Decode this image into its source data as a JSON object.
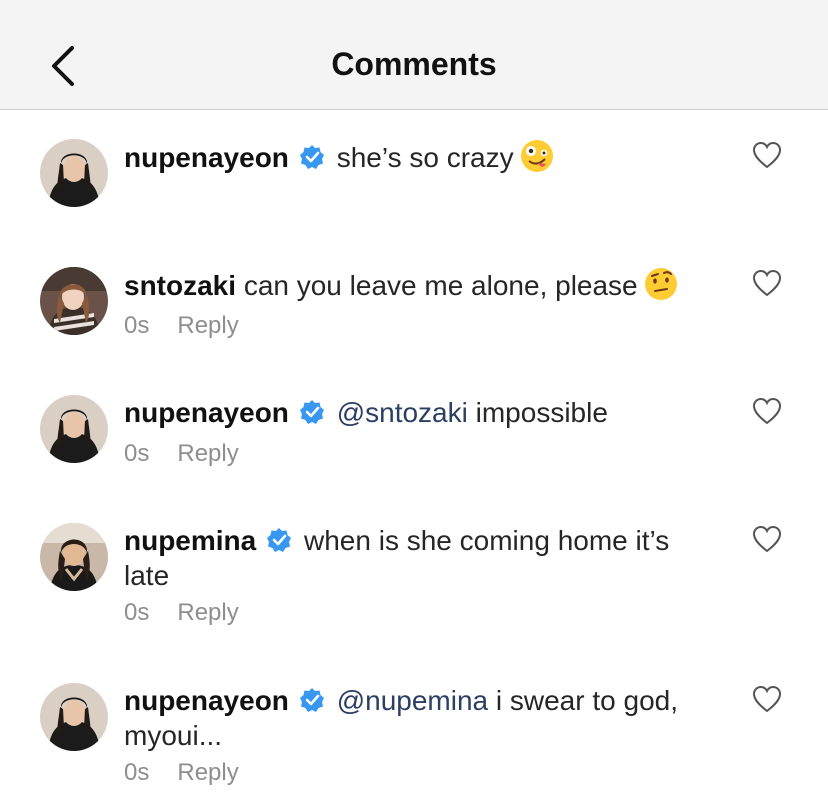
{
  "header": {
    "title": "Comments"
  },
  "comments": [
    {
      "username": "nupenayeon",
      "verified": true,
      "mention": "",
      "text": "she’s so crazy",
      "emoji": "zany-face",
      "time": "",
      "reply_label": ""
    },
    {
      "username": "sntozaki",
      "verified": false,
      "mention": "",
      "text": "can you leave me alone, please",
      "emoji": "raised-eyebrow-face",
      "time": "0s",
      "reply_label": "Reply"
    },
    {
      "username": "nupenayeon",
      "verified": true,
      "mention": "@sntozaki",
      "text": "impossible",
      "emoji": "",
      "time": "0s",
      "reply_label": "Reply"
    },
    {
      "username": "nupemina",
      "verified": true,
      "mention": "",
      "text": "when is she coming home it’s late",
      "emoji": "",
      "time": "0s",
      "reply_label": "Reply"
    },
    {
      "username": "nupenayeon",
      "verified": true,
      "mention": "@nupemina",
      "text": "i swear to god, myoui...",
      "emoji": "",
      "time": "0s",
      "reply_label": "Reply"
    }
  ],
  "colors": {
    "verified": "#3897f0",
    "mention": "#2b3f63",
    "meta": "#8e8e8e"
  }
}
